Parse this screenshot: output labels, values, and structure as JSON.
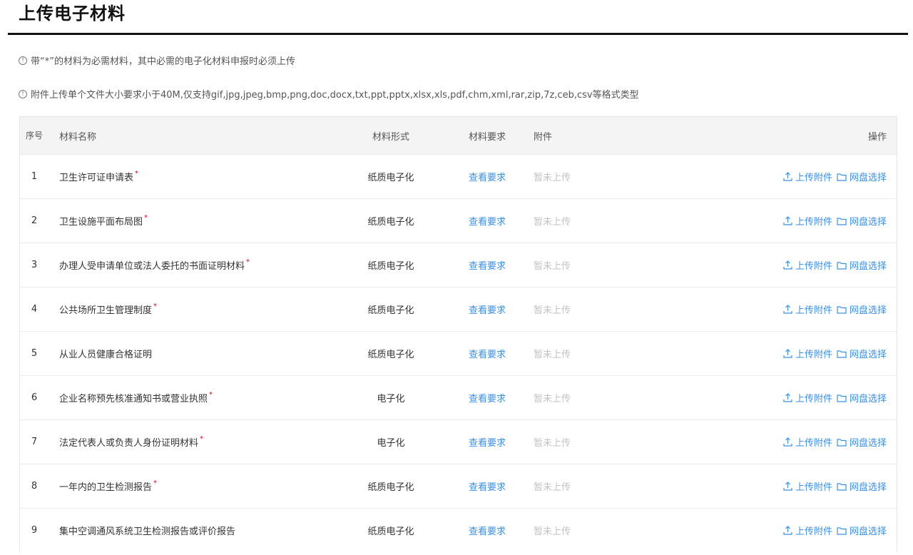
{
  "page": {
    "title": "上传电子材料"
  },
  "notices": [
    {
      "icon": "info-icon",
      "text": "带“*”的材料为必需材料，其中必需的电子化材料申报时必须上传"
    },
    {
      "icon": "info-icon",
      "text": "附件上传单个文件大小要求小于40M,仅支持gif,jpg,jpeg,bmp,png,doc,docx,txt,ppt,pptx,xlsx,xls,pdf,chm,xml,rar,zip,7z,ceb,csv等格式类型"
    }
  ],
  "table": {
    "headers": {
      "no": "序号",
      "name": "材料名称",
      "form": "材料形式",
      "requirement": "材料要求",
      "attachment": "附件",
      "operation": "操作"
    },
    "rows": [
      {
        "no": "1",
        "name": "卫生许可证申请表",
        "required": "*",
        "form": "纸质电子化",
        "requirement": "查看要求",
        "attachment": "暂未上传",
        "upload": "上传附件",
        "disk": "网盘选择"
      },
      {
        "no": "2",
        "name": "卫生设施平面布局图",
        "required": "*",
        "form": "纸质电子化",
        "requirement": "查看要求",
        "attachment": "暂未上传",
        "upload": "上传附件",
        "disk": "网盘选择"
      },
      {
        "no": "3",
        "name": "办理人受申请单位或法人委托的书面证明材料",
        "required": "*",
        "form": "纸质电子化",
        "requirement": "查看要求",
        "attachment": "暂未上传",
        "upload": "上传附件",
        "disk": "网盘选择"
      },
      {
        "no": "4",
        "name": "公共场所卫生管理制度",
        "required": "*",
        "form": "纸质电子化",
        "requirement": "查看要求",
        "attachment": "暂未上传",
        "upload": "上传附件",
        "disk": "网盘选择"
      },
      {
        "no": "5",
        "name": "从业人员健康合格证明",
        "required": "",
        "form": "纸质电子化",
        "requirement": "查看要求",
        "attachment": "暂未上传",
        "upload": "上传附件",
        "disk": "网盘选择"
      },
      {
        "no": "6",
        "name": "企业名称预先核准通知书或营业执照",
        "required": "*",
        "form": "电子化",
        "requirement": "查看要求",
        "attachment": "暂未上传",
        "upload": "上传附件",
        "disk": "网盘选择"
      },
      {
        "no": "7",
        "name": "法定代表人或负责人身份证明材料",
        "required": "*",
        "form": "电子化",
        "requirement": "查看要求",
        "attachment": "暂未上传",
        "upload": "上传附件",
        "disk": "网盘选择"
      },
      {
        "no": "8",
        "name": "一年内的卫生检测报告",
        "required": "*",
        "form": "纸质电子化",
        "requirement": "查看要求",
        "attachment": "暂未上传",
        "upload": "上传附件",
        "disk": "网盘选择"
      },
      {
        "no": "9",
        "name": "集中空调通风系统卫生检测报告或评价报告",
        "required": "",
        "form": "纸质电子化",
        "requirement": "查看要求",
        "attachment": "暂未上传",
        "upload": "上传附件",
        "disk": "网盘选择"
      }
    ]
  },
  "icons": {
    "upload": "upload-icon",
    "disk": "folder-icon"
  },
  "colors": {
    "link": "#3d8fe0",
    "required": "#d9001b",
    "muted": "#c2c2c2",
    "header_bg": "#f4f4f5"
  }
}
